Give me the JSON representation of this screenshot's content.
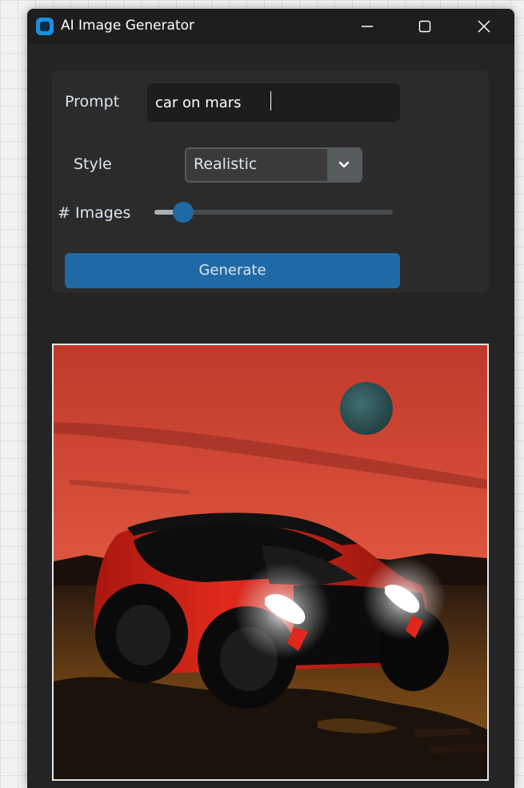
{
  "window": {
    "title": "AI Image Generator",
    "icons": [
      "app-icon",
      "minimize-icon",
      "maximize-icon",
      "close-icon"
    ]
  },
  "form": {
    "prompt_label": "Prompt",
    "prompt_value": "car on mars",
    "style_label": "Style",
    "style_value": "Realistic",
    "images_label": "# Images",
    "images_slider_fraction": 0.12,
    "generate_label": "Generate"
  },
  "colors": {
    "accent": "#1f6aa5",
    "window_bg": "#242424",
    "panel_bg": "#2b2b2b",
    "input_bg": "#1d1d1d",
    "sky": "#d8503a",
    "car_body": "#d9281e",
    "planet": "#2f5657"
  }
}
